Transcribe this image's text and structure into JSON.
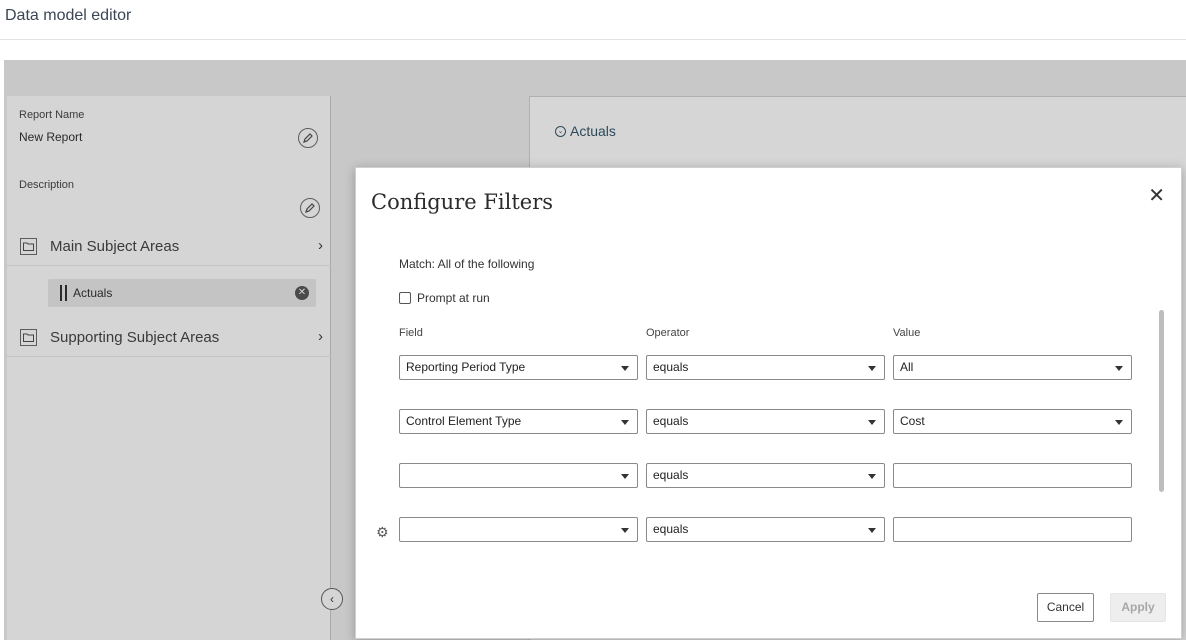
{
  "app": {
    "title": "Data model editor"
  },
  "left_panel": {
    "report_name_label": "Report Name",
    "report_name_value": "New Report",
    "description_label": "Description",
    "sections": [
      {
        "label": "Main Subject Areas",
        "items": [
          {
            "label": "Actuals"
          }
        ]
      },
      {
        "label": "Supporting Subject Areas",
        "items": []
      }
    ]
  },
  "background_card": {
    "heading": "Actuals"
  },
  "modal": {
    "title": "Configure Filters",
    "match_text": "Match: All of the following",
    "prompt_label": "Prompt at run",
    "prompt_checked": false,
    "columns": {
      "field": "Field",
      "operator": "Operator",
      "value": "Value"
    },
    "rows": [
      {
        "field": "Reporting Period Type",
        "operator": "equals",
        "value": "All",
        "value_is_select": true
      },
      {
        "field": "Control Element Type",
        "operator": "equals",
        "value": "Cost",
        "value_is_select": true
      },
      {
        "field": "",
        "operator": "equals",
        "value": "",
        "value_is_select": false
      },
      {
        "field": "",
        "operator": "equals",
        "value": "",
        "value_is_select": false
      }
    ],
    "cancel_label": "Cancel",
    "apply_label": "Apply"
  },
  "icons": {
    "edit": "pencil-icon",
    "folder": "folder-icon",
    "chevron_right": "chevron-right-icon",
    "remove": "remove-icon",
    "close": "close-icon",
    "gear": "gear-icon",
    "collapse": "chevron-left-icon"
  }
}
